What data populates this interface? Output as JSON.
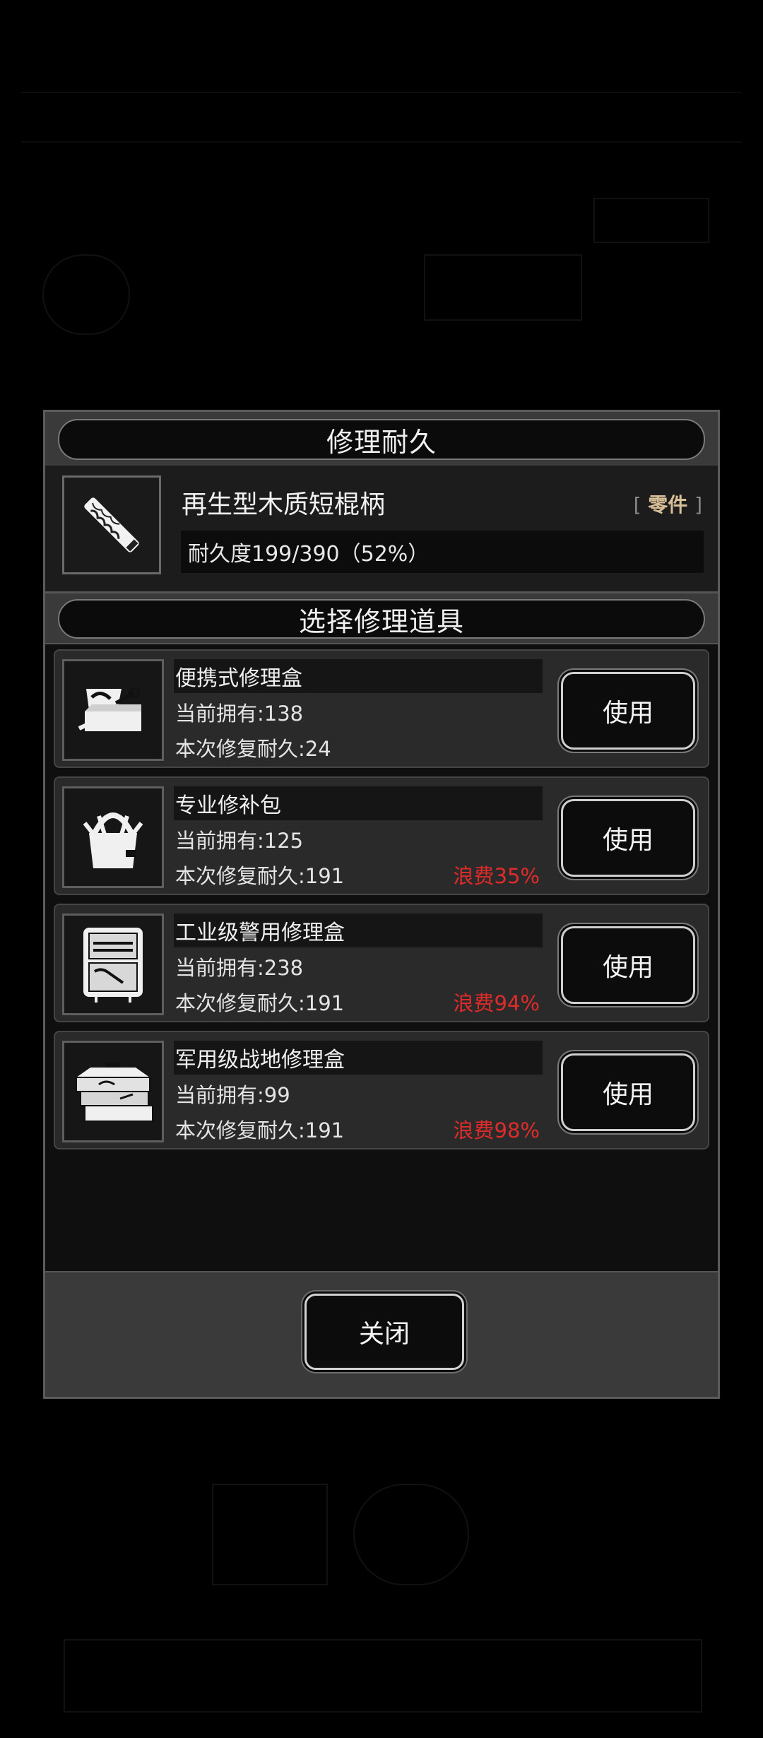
{
  "modal": {
    "title": "修理耐久",
    "item": {
      "name": "再生型木质短棍柄",
      "tag_open": "[",
      "tag": "零件",
      "tag_close": "]",
      "durability": "耐久度199/390（52%）",
      "icon": "wooden-handle-icon"
    },
    "tools_title": "选择修理道具",
    "tools": [
      {
        "name": "便携式修理盒",
        "owned": "当前拥有:138",
        "repair": "本次修复耐久:24",
        "waste": "",
        "use_label": "使用",
        "icon": "portable-toolbox-icon"
      },
      {
        "name": "专业修补包",
        "owned": "当前拥有:125",
        "repair": "本次修复耐久:191",
        "waste": "浪费35%",
        "use_label": "使用",
        "icon": "repair-bag-icon"
      },
      {
        "name": "工业级警用修理盒",
        "owned": "当前拥有:238",
        "repair": "本次修复耐久:191",
        "waste": "浪费94%",
        "use_label": "使用",
        "icon": "industrial-case-icon"
      },
      {
        "name": "军用级战地修理盒",
        "owned": "当前拥有:99",
        "repair": "本次修复耐久:191",
        "waste": "浪费98%",
        "use_label": "使用",
        "icon": "military-toolbox-icon"
      }
    ],
    "close_label": "关闭"
  },
  "colors": {
    "waste": "#e02b2b",
    "tag": "#d8bf97",
    "header": "#3a3a3a"
  }
}
